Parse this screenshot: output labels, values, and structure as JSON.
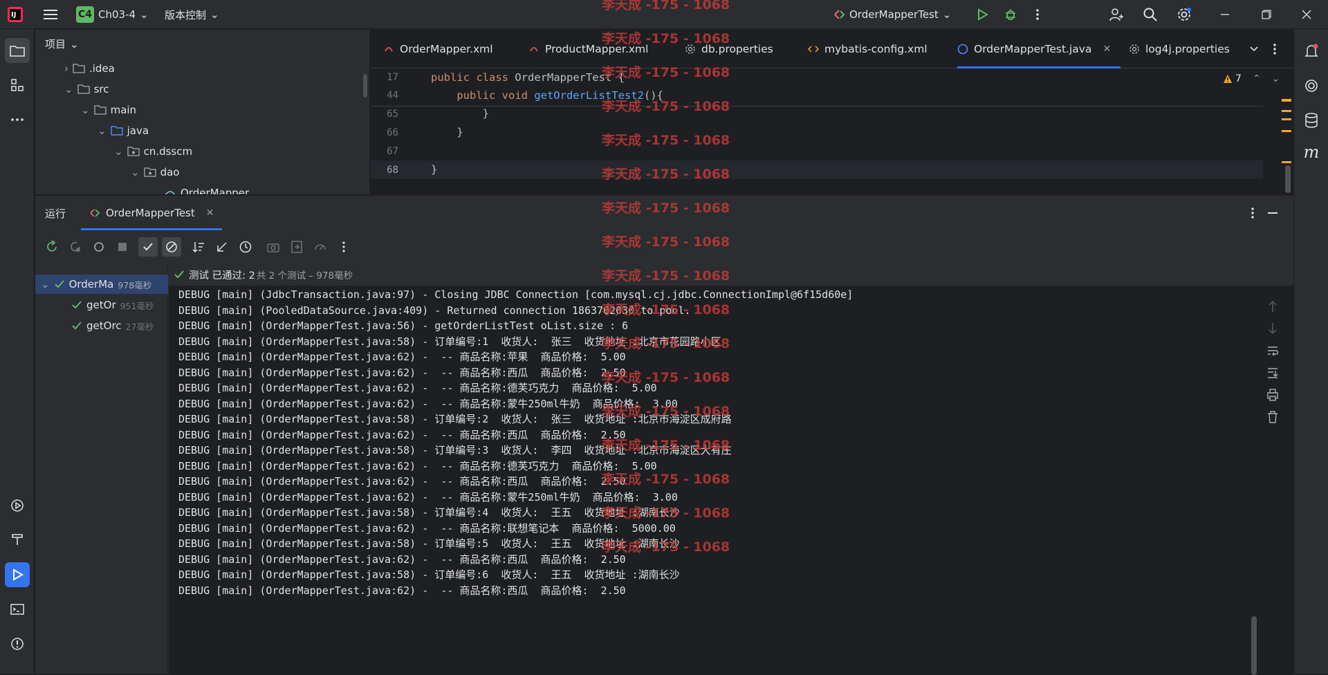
{
  "titlebar": {
    "project_badge": "C4",
    "project_name": "Ch03-4",
    "vcs_label": "版本控制",
    "run_config": "OrderMapperTest"
  },
  "project_panel": {
    "title": "项目",
    "tree": [
      {
        "label": ".idea"
      },
      {
        "label": "src"
      },
      {
        "label": "main"
      },
      {
        "label": "java"
      },
      {
        "label": "cn.dsscm"
      },
      {
        "label": "dao"
      },
      {
        "label": "OrderMapper"
      }
    ]
  },
  "editor": {
    "tabs": [
      {
        "label": "OrderMapper.xml"
      },
      {
        "label": "ProductMapper.xml"
      },
      {
        "label": "db.properties"
      },
      {
        "label": "mybatis-config.xml"
      },
      {
        "label": "OrderMapperTest.java"
      },
      {
        "label": "log4j.properties"
      }
    ],
    "warning_count": "7",
    "sticky_lines": [
      {
        "num": "17",
        "kw": "public class ",
        "rest": "OrderMapperTest {"
      },
      {
        "num": "44",
        "kw": "    public void ",
        "fn": "getOrderListTest2",
        "rest": "(){"
      }
    ],
    "lines": [
      {
        "num": "65",
        "code": "        }"
      },
      {
        "num": "66",
        "code": "    }"
      },
      {
        "num": "67",
        "code": ""
      },
      {
        "num": "68",
        "code": "}"
      }
    ]
  },
  "run": {
    "section_label": "运行",
    "tab_label": "OrderMapperTest",
    "status_prefix": "测试 已通过: 2",
    "status_suffix": "共 2 个测试 – 978毫秒",
    "test_tree": [
      {
        "name": "OrderMa",
        "time": "978毫秒"
      },
      {
        "name": "getOr",
        "time": "951毫秒"
      },
      {
        "name": "getOrc",
        "time": "27毫秒"
      }
    ],
    "log": [
      "DEBUG [main] (JdbcTransaction.java:97) - Closing JDBC Connection [com.mysql.cj.jdbc.ConnectionImpl@6f15d60e]",
      "DEBUG [main] (PooledDataSource.java:409) - Returned connection 1863702030 to pool.",
      "DEBUG [main] (OrderMapperTest.java:56) - getOrderListTest oList.size : 6",
      "DEBUG [main] (OrderMapperTest.java:58) - 订单编号:1  收货人:  张三  收货地址 :北京市花园路小区",
      "DEBUG [main] (OrderMapperTest.java:62) -  -- 商品名称:苹果  商品价格:  5.00",
      "DEBUG [main] (OrderMapperTest.java:62) -  -- 商品名称:西瓜  商品价格:  2.50",
      "DEBUG [main] (OrderMapperTest.java:62) -  -- 商品名称:德芙巧克力  商品价格:  5.00",
      "DEBUG [main] (OrderMapperTest.java:62) -  -- 商品名称:蒙牛250ml牛奶  商品价格:  3.00",
      "DEBUG [main] (OrderMapperTest.java:58) - 订单编号:2  收货人:  张三  收货地址 :北京市海淀区成府路",
      "DEBUG [main] (OrderMapperTest.java:62) -  -- 商品名称:西瓜  商品价格:  2.50",
      "DEBUG [main] (OrderMapperTest.java:58) - 订单编号:3  收货人:  李四  收货地址 :北京市海淀区大有庄",
      "DEBUG [main] (OrderMapperTest.java:62) -  -- 商品名称:德芙巧克力  商品价格:  5.00",
      "DEBUG [main] (OrderMapperTest.java:62) -  -- 商品名称:西瓜  商品价格:  2.50",
      "DEBUG [main] (OrderMapperTest.java:62) -  -- 商品名称:蒙牛250ml牛奶  商品价格:  3.00",
      "DEBUG [main] (OrderMapperTest.java:58) - 订单编号:4  收货人:  王五  收货地址 :湖南长沙",
      "DEBUG [main] (OrderMapperTest.java:62) -  -- 商品名称:联想笔记本  商品价格:  5000.00",
      "DEBUG [main] (OrderMapperTest.java:58) - 订单编号:5  收货人:  王五  收货地址 :湖南长沙",
      "DEBUG [main] (OrderMapperTest.java:62) -  -- 商品名称:西瓜  商品价格:  2.50",
      "DEBUG [main] (OrderMapperTest.java:58) - 订单编号:6  收货人:  王五  收货地址 :湖南长沙",
      "DEBUG [main] (OrderMapperTest.java:62) -  -- 商品名称:西瓜  商品价格:  2.50"
    ]
  },
  "watermark": "李天成 -175 - 1068",
  "colors": {
    "accent": "#3574f0",
    "pass": "#5fb865",
    "warning": "#f0a732",
    "watermark": "#c03a38"
  }
}
